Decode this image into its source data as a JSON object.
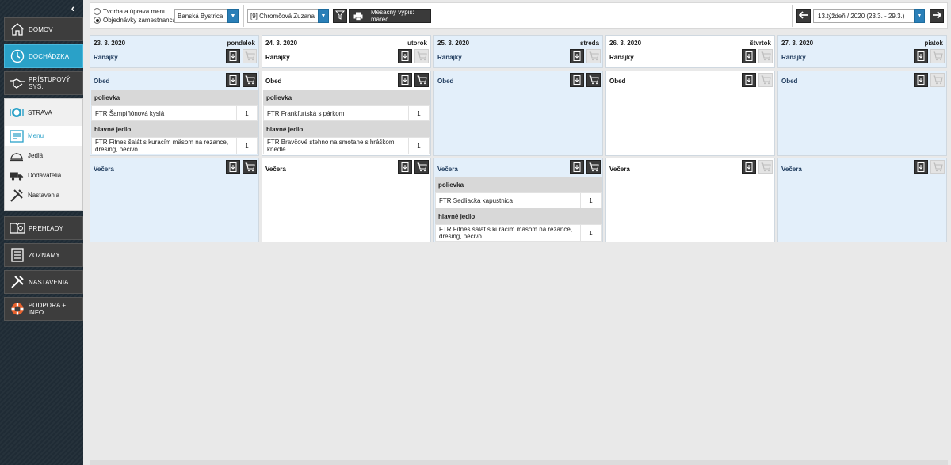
{
  "sidebar": {
    "collapse_glyph": "‹",
    "nav": [
      {
        "label": "DOMOV",
        "icon": "home-icon"
      },
      {
        "label": "DOCHÁDZKA",
        "icon": "clock-icon"
      },
      {
        "label": "PRÍSTUPOVÝ SYS.",
        "icon": "handshake-icon"
      },
      {
        "label": "PREHĽADY",
        "icon": "book-search-icon"
      },
      {
        "label": "ZOZNAMY",
        "icon": "list-icon"
      },
      {
        "label": "NASTAVENIA",
        "icon": "tools-icon"
      },
      {
        "label": "PODPORA + INFO",
        "icon": "lifebuoy-icon"
      }
    ],
    "strava": {
      "head": "STRAVA",
      "items": [
        "Menu",
        "Jedlá",
        "Dodávatelia",
        "Nastavenia"
      ]
    }
  },
  "toolbar": {
    "radio1": "Tvorba a úprava menu",
    "radio2": "Objednávky zamestnanca",
    "location": "Banská Bystrica",
    "employee": "[9] Chromčová Zuzana",
    "monthly_btn": "Mesačný výpis: marec",
    "week": "13.týždeň / 2020 (23.3. - 29.3.)"
  },
  "days": [
    {
      "date": "23. 3. 2020",
      "weekday": "pondelok",
      "breakfast": "Raňajky",
      "lunch": "Obed",
      "dinner": "Večera",
      "lunch_sections": [
        {
          "title": "polievka",
          "items": [
            {
              "name": "FTR Šampiňónová kyslá",
              "qty": "1"
            }
          ]
        },
        {
          "title": "hlavné jedlo",
          "items": [
            {
              "name": "FTR Fitnes šalát s kuracím mäsom na rezance, dresing, pečivo",
              "qty": "1"
            }
          ]
        }
      ]
    },
    {
      "date": "24. 3. 2020",
      "weekday": "utorok",
      "breakfast": "Raňajky",
      "lunch": "Obed",
      "dinner": "Večera",
      "lunch_sections": [
        {
          "title": "polievka",
          "items": [
            {
              "name": "FTR Frankfurtská s párkom",
              "qty": "1"
            }
          ]
        },
        {
          "title": "hlavné jedlo",
          "items": [
            {
              "name": "FTR Bravčové stehno na smotane s hráškom, knedle",
              "qty": "1"
            }
          ]
        }
      ]
    },
    {
      "date": "25. 3. 2020",
      "weekday": "streda",
      "breakfast": "Raňajky",
      "lunch": "Obed",
      "dinner": "Večera",
      "dinner_sections": [
        {
          "title": "polievka",
          "items": [
            {
              "name": "FTR Sedliacka kapustnica",
              "qty": "1"
            }
          ]
        },
        {
          "title": "hlavné jedlo",
          "items": [
            {
              "name": "FTR Fitnes šalát s kuracím mäsom na rezance, dresing, pečivo",
              "qty": "1"
            }
          ]
        }
      ]
    },
    {
      "date": "26. 3. 2020",
      "weekday": "štvrtok",
      "breakfast": "Raňajky",
      "lunch": "Obed",
      "dinner": "Večera"
    },
    {
      "date": "27. 3. 2020",
      "weekday": "piatok",
      "breakfast": "Raňajky",
      "lunch": "Obed",
      "dinner": "Večera"
    }
  ],
  "colors": {
    "accent": "#2aa1c8",
    "sidebar_bg": "#1f2b35",
    "card_blue": "#e3effa",
    "section_gray": "#d8d8d8",
    "dark_button": "#3a3a3a",
    "select_arrow": "#2a7fb8"
  }
}
